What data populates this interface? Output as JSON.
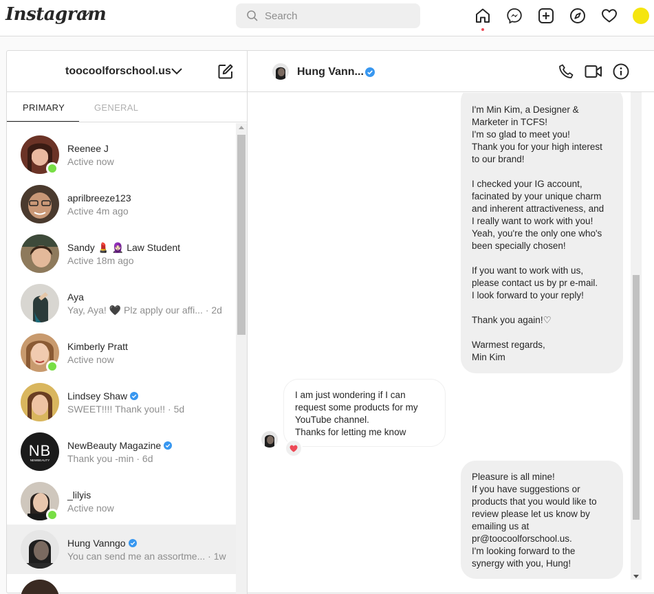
{
  "app": {
    "logo_text": "Instagram",
    "search_placeholder": "Search"
  },
  "nav_icons": [
    "home-icon",
    "messenger-icon",
    "new-post-icon",
    "explore-icon",
    "activity-heart-icon"
  ],
  "inbox": {
    "account_name": "toocoolforschool.us",
    "tabs": [
      {
        "label": "PRIMARY",
        "active": true
      },
      {
        "label": "GENERAL",
        "active": false
      }
    ],
    "threads": [
      {
        "name": "Reenee J",
        "subtitle": "Active now",
        "online": true,
        "verified": false,
        "active": false,
        "avatar_color": "#7a3b2a"
      },
      {
        "name": "aprilbreeze123",
        "subtitle": "Active 4m ago",
        "online": false,
        "verified": false,
        "active": false,
        "avatar_color": "#5a4636"
      },
      {
        "name": "Sandy 💄 🧕🏻 Law Student",
        "subtitle": "Active 18m ago",
        "online": false,
        "verified": false,
        "active": false,
        "avatar_color": "#9a7a55"
      },
      {
        "name": "Aya",
        "subtitle": "Yay, Aya! 🖤 Plz apply our affi... · 2d",
        "online": false,
        "verified": false,
        "active": false,
        "avatar_color": "#c9c7c2"
      },
      {
        "name": "Kimberly Pratt",
        "subtitle": "Active now",
        "online": true,
        "verified": false,
        "active": false,
        "avatar_color": "#b07e5a"
      },
      {
        "name": "Lindsey Shaw",
        "subtitle": "SWEET!!!! Thank you!! · 5d",
        "online": false,
        "verified": true,
        "active": false,
        "avatar_color": "#c49a56"
      },
      {
        "name": "NewBeauty Magazine",
        "subtitle": "Thank you -min · 6d",
        "online": false,
        "verified": true,
        "active": false,
        "avatar_color": "#1b1b1b"
      },
      {
        "name": "_lilyis",
        "subtitle": "Active now",
        "online": true,
        "verified": false,
        "active": false,
        "avatar_color": "#8d7a6c"
      },
      {
        "name": "Hung Vanngo",
        "subtitle": "You can send me an assortme... · 1w",
        "online": false,
        "verified": true,
        "active": true,
        "avatar_color": "#3a3a3a"
      }
    ]
  },
  "chat": {
    "contact_name": "Hung Vann...",
    "messages": [
      {
        "from": "me",
        "text": "I'm Min Kim, a Designer &\nMarketer in TCFS!\nI'm so glad to meet you!\nThank you for your high interest\nto our brand!\n\nI checked your IG account,\nfacinated by your unique charm\nand inherent attractiveness, and\nI really want to work with you!\nYeah, you're the only one who's\nbeen specially chosen!\n\nIf you want to work with us,\nplease contact us by pr e-mail.\nI look forward to your reply!\n\nThank you again!♡\n\nWarmest regards,\nMin Kim"
      },
      {
        "from": "them",
        "text": "I am just wondering if I can\nrequest some products for my\nYouTube channel.\nThanks for letting me know",
        "reaction": "❤"
      },
      {
        "from": "me",
        "text": "Pleasure is all mine!\nIf you have suggestions or\nproducts that you would like to\nreview please let us know by\nemailing us at\npr@toocoolforschool.us.\nI'm looking forward to the\nsynergy with you, Hung!"
      }
    ]
  },
  "colors": {
    "online": "#78de45",
    "verified": "#3897f0",
    "notification_dot": "#ed4956",
    "reaction_heart": "#ed4956",
    "bubble_mine": "#efefef"
  }
}
